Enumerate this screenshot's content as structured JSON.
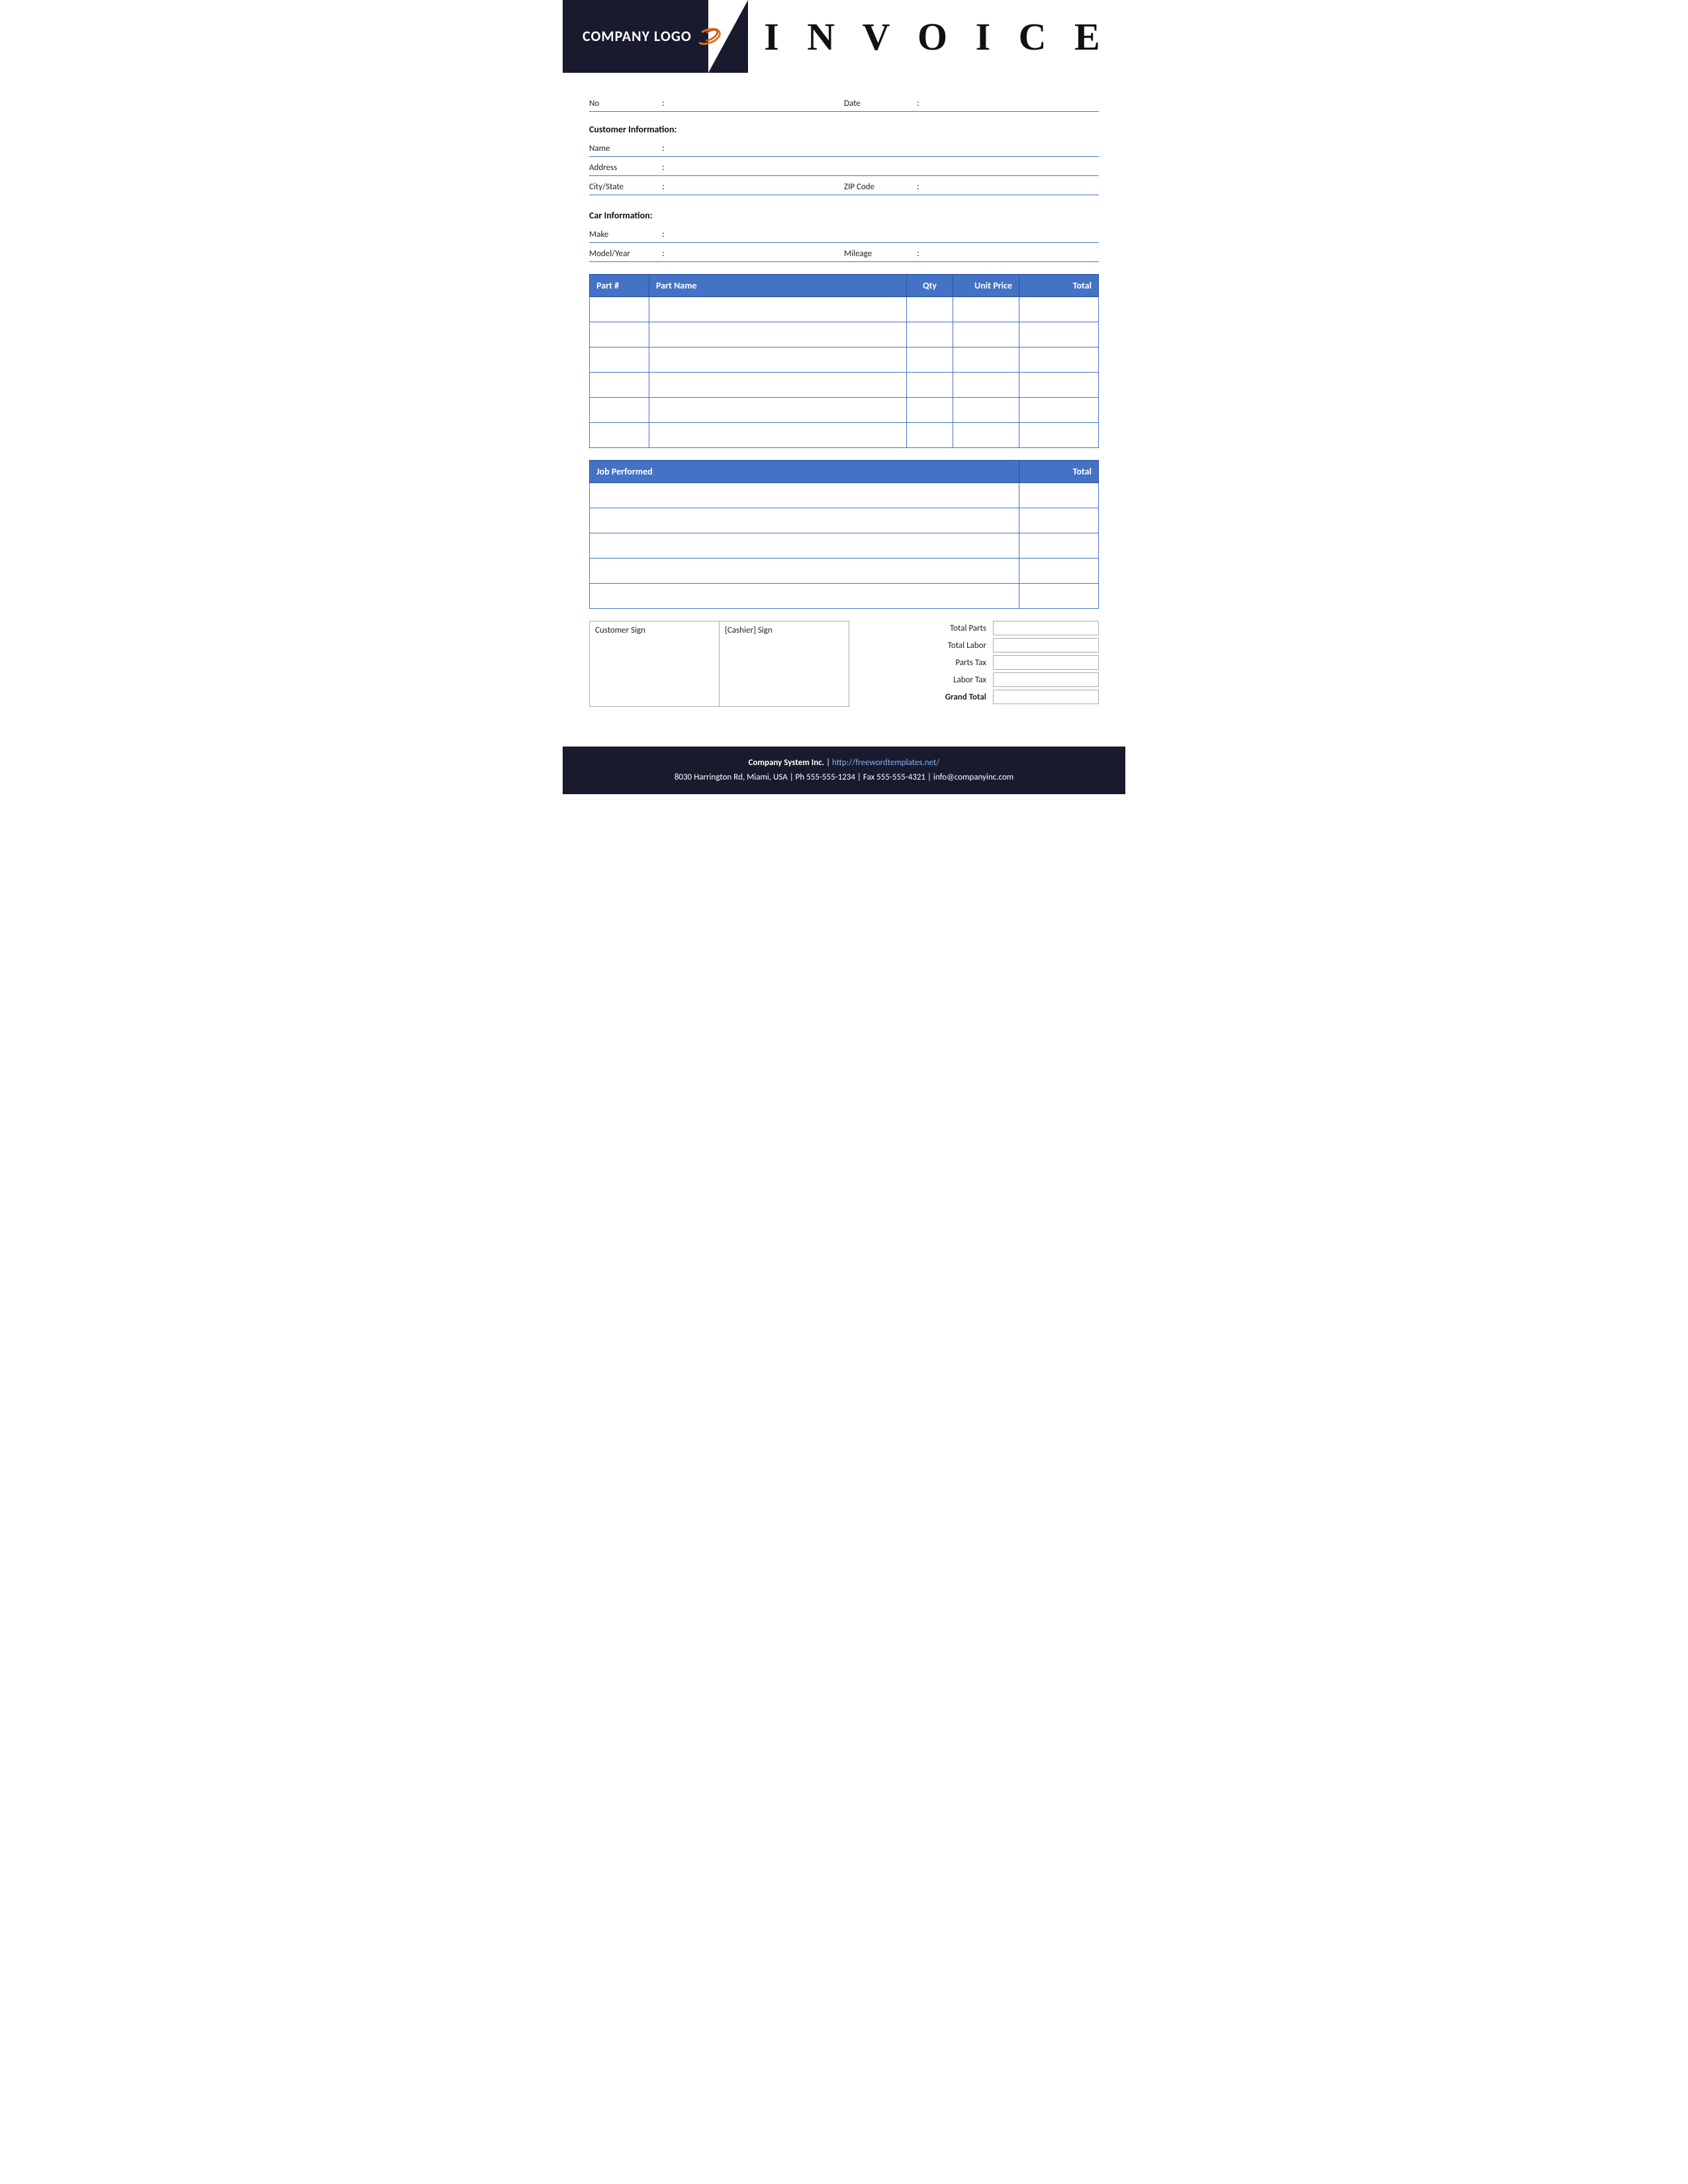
{
  "header": {
    "logo_text": "COMPANY LOGO",
    "title": "I N V O I C E"
  },
  "form": {
    "no_label": "No",
    "no_colon": ":",
    "date_label": "Date",
    "date_colon": ":",
    "customer_section_title": "Customer Information:",
    "name_label": "Name",
    "name_colon": ":",
    "address_label": "Address",
    "address_colon": ":",
    "citystate_label": "City/State",
    "citystate_colon": ":",
    "zipcode_label": "ZIP Code",
    "zipcode_colon": ":",
    "car_section_title": "Car Information:",
    "make_label": "Make",
    "make_colon": ":",
    "modelyear_label": "Model/Year",
    "modelyear_colon": ":",
    "mileage_label": "Mileage",
    "mileage_colon": ":"
  },
  "parts_table": {
    "headers": [
      "Part #",
      "Part Name",
      "Qty",
      "Unit Price",
      "Total"
    ],
    "rows": [
      {
        "partnum": "",
        "partname": "",
        "qty": "",
        "unitprice": "",
        "total": ""
      },
      {
        "partnum": "",
        "partname": "",
        "qty": "",
        "unitprice": "",
        "total": ""
      },
      {
        "partnum": "",
        "partname": "",
        "qty": "",
        "unitprice": "",
        "total": ""
      },
      {
        "partnum": "",
        "partname": "",
        "qty": "",
        "unitprice": "",
        "total": ""
      },
      {
        "partnum": "",
        "partname": "",
        "qty": "",
        "unitprice": "",
        "total": ""
      },
      {
        "partnum": "",
        "partname": "",
        "qty": "",
        "unitprice": "",
        "total": ""
      }
    ]
  },
  "job_table": {
    "headers": [
      "Job Performed",
      "Total"
    ],
    "rows": [
      {
        "job": "",
        "total": ""
      },
      {
        "job": "",
        "total": ""
      },
      {
        "job": "",
        "total": ""
      },
      {
        "job": "",
        "total": ""
      },
      {
        "job": "",
        "total": ""
      }
    ]
  },
  "sign": {
    "customer_sign_label": "Customer Sign",
    "cashier_sign_label": "[Cashier] Sign"
  },
  "totals": {
    "total_parts_label": "Total Parts",
    "total_labor_label": "Total Labor",
    "parts_tax_label": "Parts Tax",
    "labor_tax_label": "Labor Tax",
    "grand_total_label": "Grand Total"
  },
  "footer": {
    "company": "Company System Inc.",
    "separator": "|",
    "website": "http://freewordtemplates.net/",
    "address": "8030 Harrington Rd, Miami, USA | Ph 555-555-1234 | Fax 555-555-4321 | info@companyinc.com"
  }
}
